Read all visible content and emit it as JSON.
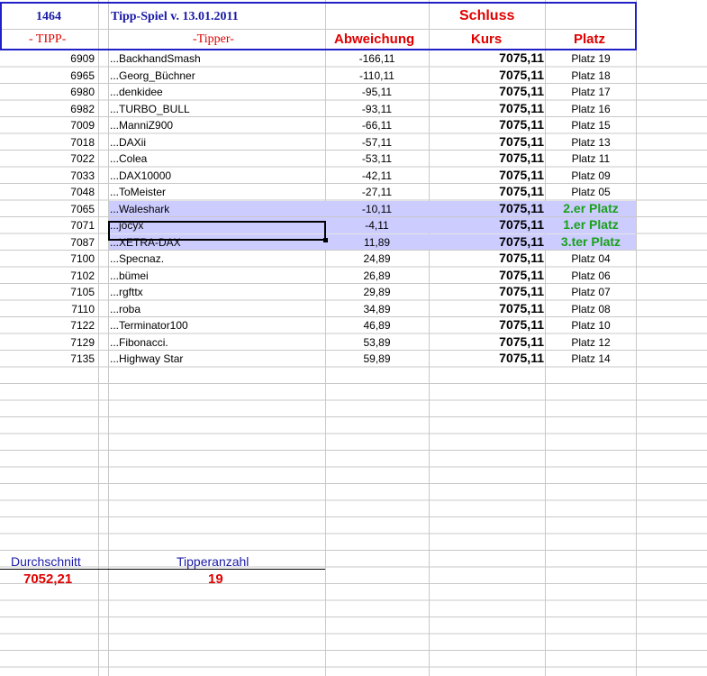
{
  "header": {
    "id": "1464",
    "title": "Tipp-Spiel v. 13.01.2011",
    "schluss": "Schluss",
    "col_tipp": "- TIPP-",
    "col_tipper": "-Tipper-",
    "col_abweichung": "Abweichung",
    "col_kurs": "Kurs",
    "col_platz": "Platz"
  },
  "rows": [
    {
      "tipp": "6909",
      "tipper": "...BackhandSmash",
      "abw": "-166,11",
      "kurs": "7075,11",
      "platz": "Platz 19"
    },
    {
      "tipp": "6965",
      "tipper": "...Georg_Büchner",
      "abw": "-110,11",
      "kurs": "7075,11",
      "platz": "Platz 18"
    },
    {
      "tipp": "6980",
      "tipper": "...denkidee",
      "abw": "-95,11",
      "kurs": "7075,11",
      "platz": "Platz 17"
    },
    {
      "tipp": "6982",
      "tipper": "...TURBO_BULL",
      "abw": "-93,11",
      "kurs": "7075,11",
      "platz": "Platz 16"
    },
    {
      "tipp": "7009",
      "tipper": "...ManniZ900",
      "abw": "-66,11",
      "kurs": "7075,11",
      "platz": "Platz 15"
    },
    {
      "tipp": "7018",
      "tipper": "...DAXii",
      "abw": "-57,11",
      "kurs": "7075,11",
      "platz": "Platz 13"
    },
    {
      "tipp": "7022",
      "tipper": "...Colea",
      "abw": "-53,11",
      "kurs": "7075,11",
      "platz": "Platz 11"
    },
    {
      "tipp": "7033",
      "tipper": "...DAX10000",
      "abw": "-42,11",
      "kurs": "7075,11",
      "platz": "Platz 09"
    },
    {
      "tipp": "7048",
      "tipper": "...ToMeister",
      "abw": "-27,11",
      "kurs": "7075,11",
      "platz": "Platz 05"
    },
    {
      "tipp": "7065",
      "tipper": "...Waleshark",
      "abw": "-10,11",
      "kurs": "7075,11",
      "platz": "2.er Platz",
      "winner": true
    },
    {
      "tipp": "7071",
      "tipper": "...jocyx",
      "abw": "-4,11",
      "kurs": "7075,11",
      "platz": "1.er Platz",
      "winner": true
    },
    {
      "tipp": "7087",
      "tipper": "...XETRA-DAX",
      "abw": "11,89",
      "kurs": "7075,11",
      "platz": "3.ter Platz",
      "winner": true
    },
    {
      "tipp": "7100",
      "tipper": "...Specnaz.",
      "abw": "24,89",
      "kurs": "7075,11",
      "platz": "Platz 04"
    },
    {
      "tipp": "7102",
      "tipper": "...bümei",
      "abw": "26,89",
      "kurs": "7075,11",
      "platz": "Platz 06"
    },
    {
      "tipp": "7105",
      "tipper": "...rgfttx",
      "abw": "29,89",
      "kurs": "7075,11",
      "platz": "Platz 07"
    },
    {
      "tipp": "7110",
      "tipper": "...roba",
      "abw": "34,89",
      "kurs": "7075,11",
      "platz": "Platz 08"
    },
    {
      "tipp": "7122",
      "tipper": "...Terminator100",
      "abw": "46,89",
      "kurs": "7075,11",
      "platz": "Platz 10"
    },
    {
      "tipp": "7129",
      "tipper": "...Fibonacci.",
      "abw": "53,89",
      "kurs": "7075,11",
      "platz": "Platz 12"
    },
    {
      "tipp": "7135",
      "tipper": "...Highway Star",
      "abw": "59,89",
      "kurs": "7075,11",
      "platz": "Platz 14"
    }
  ],
  "summary": {
    "avg_label": "Durchschnitt",
    "avg_value": "7052,21",
    "count_label": "Tipperanzahl",
    "count_value": "19"
  }
}
